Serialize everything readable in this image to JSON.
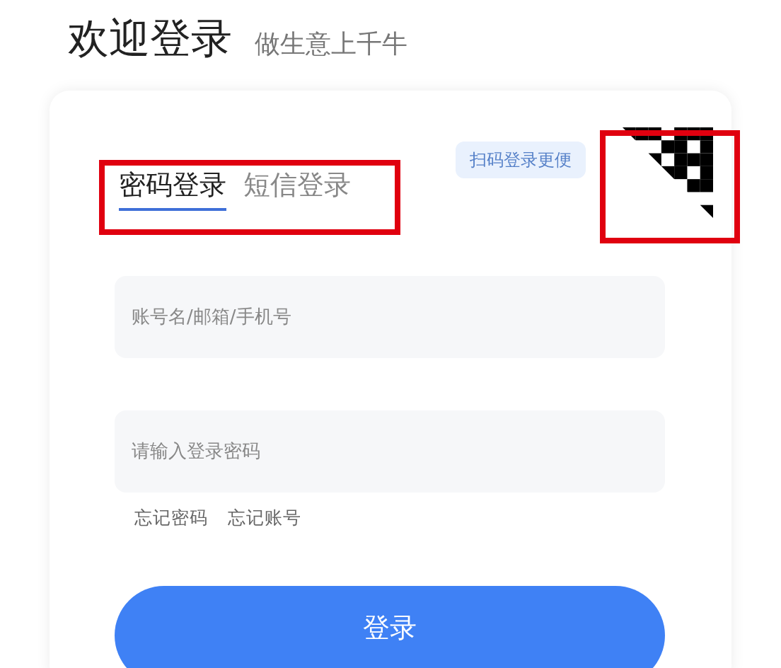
{
  "header": {
    "title": "欢迎登录",
    "slogan": "做生意上千牛"
  },
  "tabs": [
    {
      "label": "密码登录",
      "selected": true
    },
    {
      "label": "短信登录",
      "selected": false
    }
  ],
  "qr_hint": "扫码登录更便",
  "fields": [
    {
      "placeholder": "账号名/邮箱/手机号"
    },
    {
      "placeholder": "请输入登录密码"
    }
  ],
  "links": [
    "忘记密码",
    "忘记账号"
  ],
  "submit": "登录"
}
